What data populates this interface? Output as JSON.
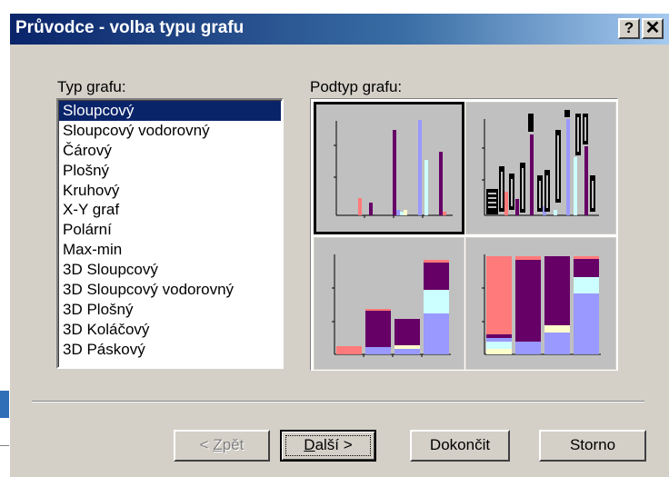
{
  "window": {
    "title": "Průvodce - volba typu grafu",
    "help_glyph": "?",
    "close_glyph": "✕"
  },
  "chart_type": {
    "label": "Typ grafu:",
    "items": [
      "Sloupcový",
      "Sloupcový vodorovný",
      "Čárový",
      "Plošný",
      "Kruhový",
      "X-Y graf",
      "Polární",
      "Max-min",
      "3D Sloupcový",
      "3D Sloupcový vodorovný",
      "3D Plošný",
      "3D Koláčový",
      "3D Páskový"
    ],
    "selected_index": 0
  },
  "chart_subtype": {
    "label": "Podtyp grafu:",
    "selected_index": 0,
    "colors": {
      "salmon": "#ff7a7a",
      "purple": "#660066",
      "lavender": "#9999ff",
      "light_cyan": "#ccffff",
      "light_yellow": "#ffffcc",
      "cell_bg": "#c0c0c0"
    }
  },
  "buttons": {
    "back_prefix": "< ",
    "back_accel": "Z",
    "back_rest": "pět",
    "next_accel": "D",
    "next_rest": "alší >",
    "finish": "Dokončit",
    "cancel": "Storno"
  }
}
